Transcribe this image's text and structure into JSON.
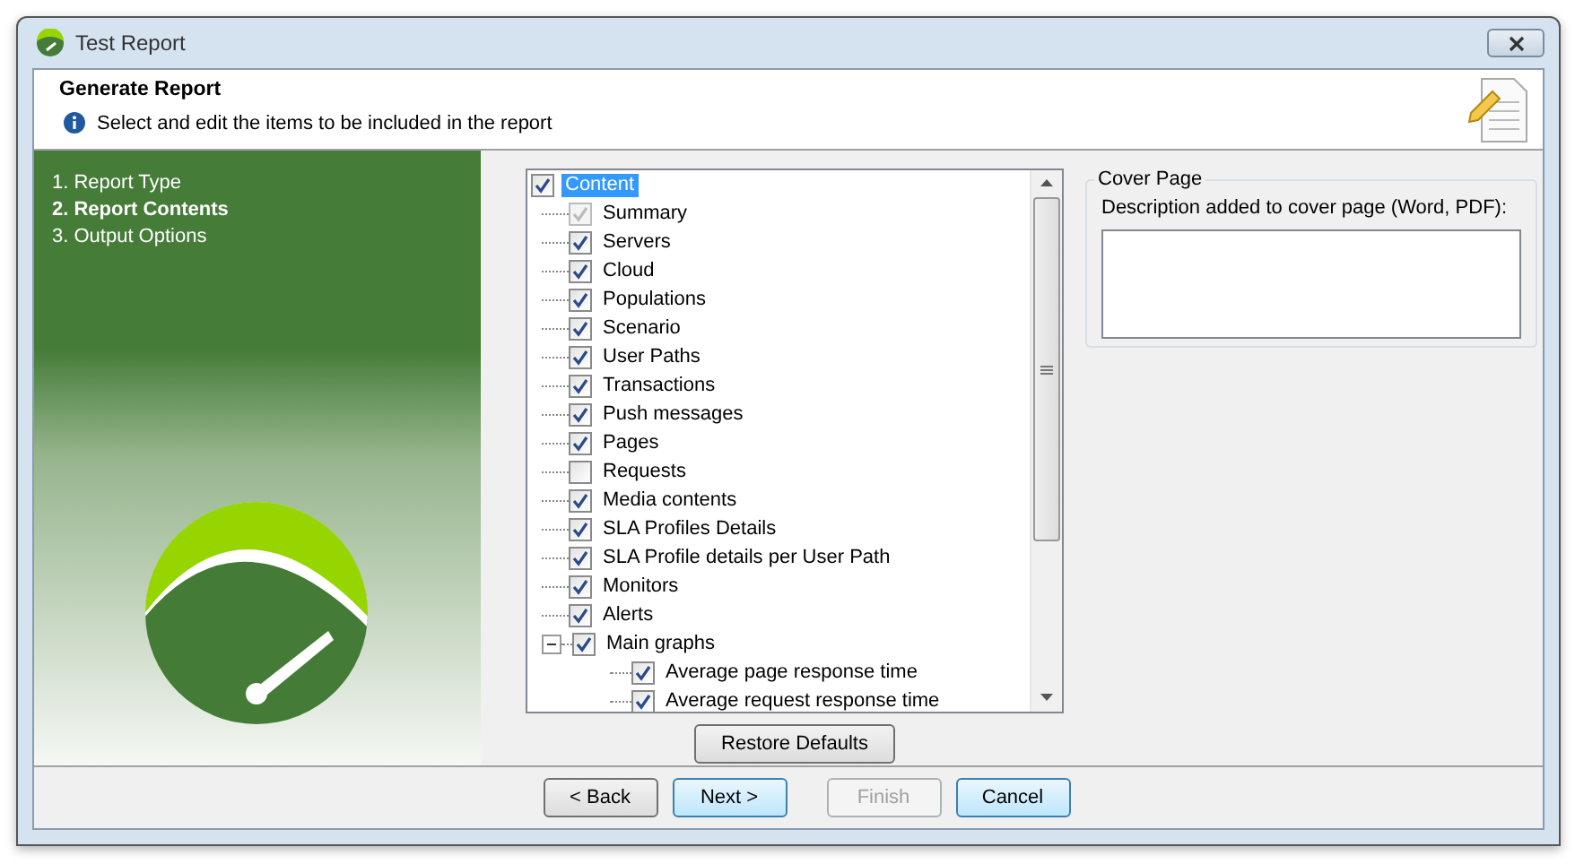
{
  "window": {
    "title": "Test Report"
  },
  "header": {
    "title": "Generate Report",
    "hint": "Select and edit the items to be included in the report"
  },
  "steps": [
    {
      "label": "1. Report Type",
      "selected": false
    },
    {
      "label": "2. Report Contents",
      "selected": true
    },
    {
      "label": "3. Output Options",
      "selected": false
    }
  ],
  "tree": {
    "label": "Content",
    "checked": true,
    "selected": true,
    "children": [
      {
        "label": "Summary",
        "checked": true,
        "disabled": true
      },
      {
        "label": "Servers",
        "checked": true,
        "disabled": false
      },
      {
        "label": "Cloud",
        "checked": true,
        "disabled": false
      },
      {
        "label": "Populations",
        "checked": true,
        "disabled": false
      },
      {
        "label": "Scenario",
        "checked": true,
        "disabled": false
      },
      {
        "label": "User Paths",
        "checked": true,
        "disabled": false
      },
      {
        "label": "Transactions",
        "checked": true,
        "disabled": false
      },
      {
        "label": "Push messages",
        "checked": true,
        "disabled": false
      },
      {
        "label": "Pages",
        "checked": true,
        "disabled": false
      },
      {
        "label": "Requests",
        "checked": false,
        "disabled": false
      },
      {
        "label": "Media contents",
        "checked": true,
        "disabled": false
      },
      {
        "label": "SLA Profiles Details",
        "checked": true,
        "disabled": false
      },
      {
        "label": "SLA Profile details per User Path",
        "checked": true,
        "disabled": false
      },
      {
        "label": "Monitors",
        "checked": true,
        "disabled": false
      },
      {
        "label": "Alerts",
        "checked": true,
        "disabled": false
      },
      {
        "label": "Main graphs",
        "checked": true,
        "disabled": false,
        "expanded": true,
        "children": [
          {
            "label": "Average page response time",
            "checked": true,
            "disabled": false
          },
          {
            "label": "Average request response time",
            "checked": true,
            "disabled": false
          }
        ]
      }
    ]
  },
  "restore_button": "Restore Defaults",
  "cover_page": {
    "title": "Cover Page",
    "label": "Description added to cover page (Word, PDF):"
  },
  "buttons": [
    {
      "label": "< Back",
      "disabled": false,
      "highlighted": false
    },
    {
      "label": "Next >",
      "disabled": false,
      "highlighted": true
    },
    {
      "label": "Finish",
      "disabled": true,
      "highlighted": false
    },
    {
      "label": "Cancel",
      "disabled": false,
      "highlighted": true
    }
  ]
}
